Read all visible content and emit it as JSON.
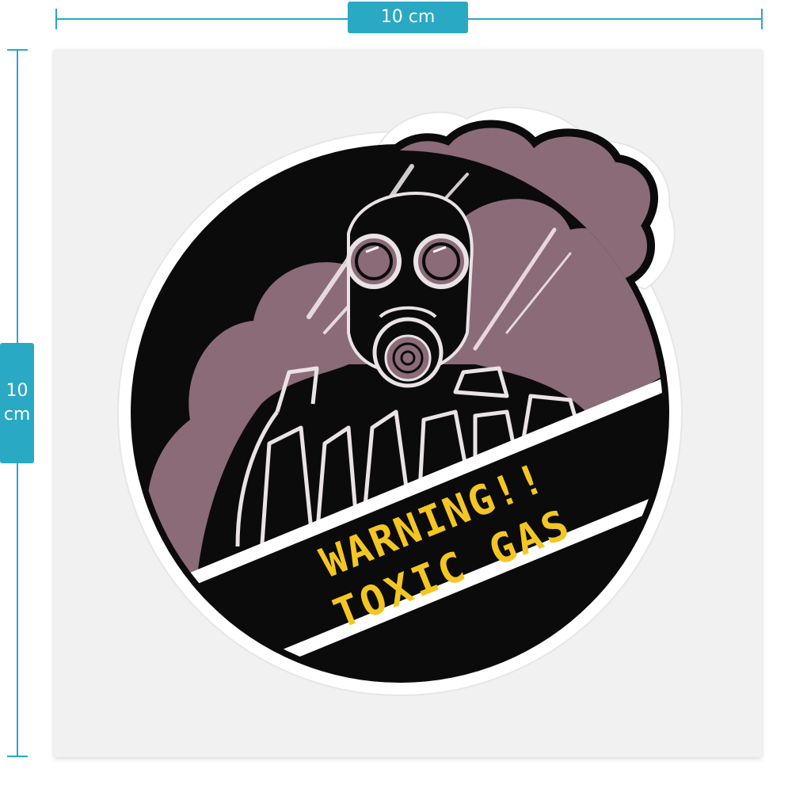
{
  "dimensions": {
    "width_label": "10 cm",
    "height_label_value": "10",
    "height_label_unit": "cm"
  },
  "sticker": {
    "headline_line1": "WARNING!!",
    "headline_line2": "TOXIC GAS",
    "text_color": "#f3c623"
  },
  "colors": {
    "accent": "#29a9c4",
    "smoke": "#8b6b78",
    "ink": "#0b0b0b",
    "backing": "#f0f0f0"
  }
}
